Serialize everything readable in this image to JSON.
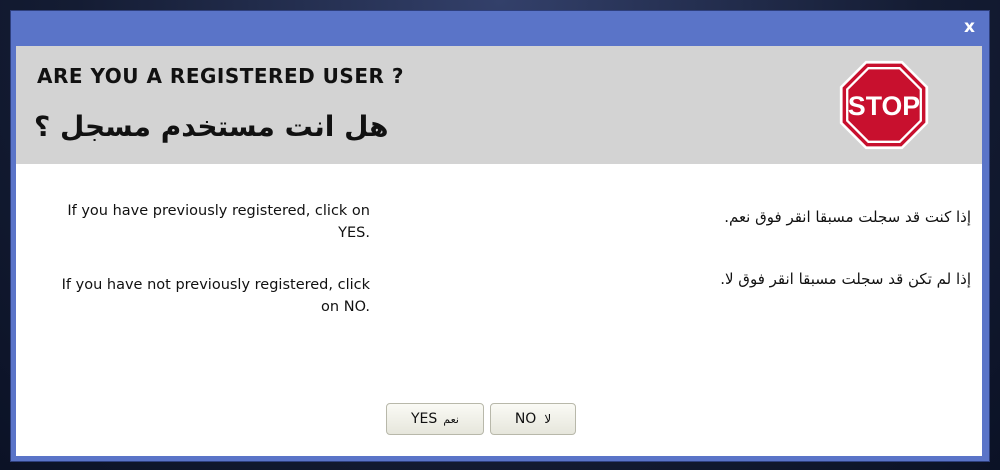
{
  "dialog": {
    "close_label": "x",
    "title_en": "ARE YOU A REGISTERED USER ?",
    "title_ar": "هل انت مستخدم مسجل ؟",
    "stop_sign_text": "STOP",
    "en_registered": "If you have previously registered, click on YES.",
    "en_not_registered": "If you have not previously registered, click on NO.",
    "ar_registered": "إذا كنت قد سجلت مسبقا انقر فوق نعم.",
    "ar_not_registered": "إذا لم تكن قد سجلت مسبقا انقر فوق لا.",
    "yes_label": "YES",
    "yes_label_ar": "نعم",
    "no_label": "NO",
    "no_label_ar": "لا"
  },
  "colors": {
    "titlebar": "#5a74c8",
    "header_bg": "#d3d3d3",
    "stop_red": "#c8102e"
  },
  "icons": [
    "close-icon",
    "stop-sign-icon"
  ]
}
